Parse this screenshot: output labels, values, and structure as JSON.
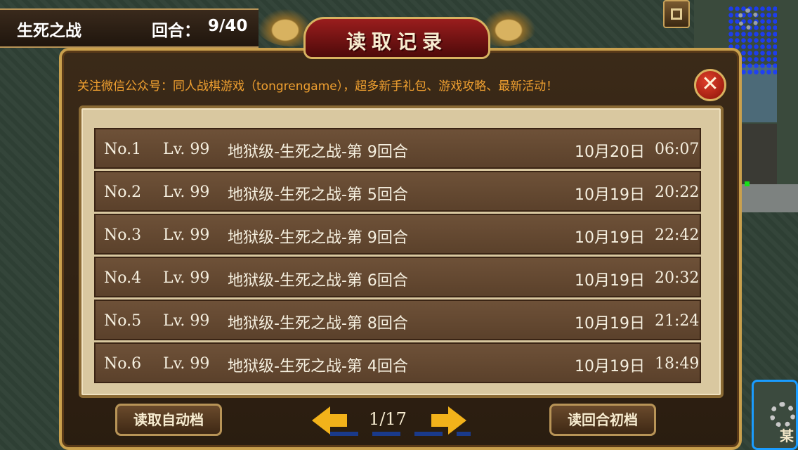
{
  "status": {
    "battle_title": "生死之战",
    "round_label": "回合：",
    "round_value": "9/40"
  },
  "dialog": {
    "title": "读取记录",
    "notice": "关注微信公众号：同人战棋游戏（tongrengame），超多新手礼包、游戏攻略、最新活动！",
    "close_label": "✕"
  },
  "saves": [
    {
      "no": "No.1",
      "lv": "Lv. 99",
      "name": "地狱级-生死之战-第 9回合",
      "date": "10月20日",
      "time": "06:07"
    },
    {
      "no": "No.2",
      "lv": "Lv. 99",
      "name": "地狱级-生死之战-第 5回合",
      "date": "10月19日",
      "time": "20:22"
    },
    {
      "no": "No.3",
      "lv": "Lv. 99",
      "name": "地狱级-生死之战-第 9回合",
      "date": "10月19日",
      "time": "22:42"
    },
    {
      "no": "No.4",
      "lv": "Lv. 99",
      "name": "地狱级-生死之战-第 6回合",
      "date": "10月19日",
      "time": "20:32"
    },
    {
      "no": "No.5",
      "lv": "Lv. 99",
      "name": "地狱级-生死之战-第 8回合",
      "date": "10月19日",
      "time": "21:24"
    },
    {
      "no": "No.6",
      "lv": "Lv. 99",
      "name": "地狱级-生死之战-第 4回合",
      "date": "10月19日",
      "time": "18:49"
    }
  ],
  "footer": {
    "auto_save_label": "读取自动档",
    "page": "1/17",
    "round_start_label": "读回合初档"
  },
  "side": {
    "char": "某"
  },
  "colors": {
    "notice": "#f0a030",
    "arrow": "#f2b21a",
    "slot_bg": "#5b412b",
    "frame_gold": "#c9a04d"
  }
}
